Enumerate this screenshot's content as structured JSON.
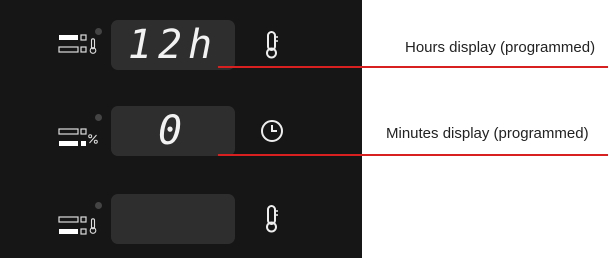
{
  "rows": [
    {
      "display": "12h",
      "mode_icon": "thermometer-icon",
      "side_icon": "thermometer-icon"
    },
    {
      "display": "0",
      "mode_icon": "percent-icon",
      "side_icon": "clock-icon"
    },
    {
      "display": "",
      "mode_icon": "thermometer-icon",
      "side_icon": "thermometer-icon"
    }
  ],
  "callouts": {
    "hours": "Hours display (programmed)",
    "minutes": "Minutes display (programmed)"
  },
  "colors": {
    "panel": "#161616",
    "screen": "#2e2e2e",
    "segment": "#f2f2f2",
    "callout_line": "#d82020"
  }
}
